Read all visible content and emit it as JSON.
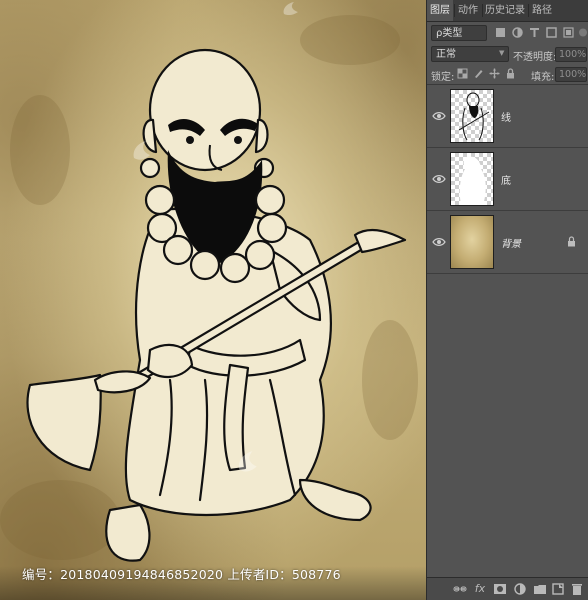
{
  "canvas": {
    "watermark": "编号：20180409194846852020 上传者ID：508776"
  },
  "panel": {
    "tabs": [
      "图层",
      "动作",
      "历史记录",
      "路径"
    ],
    "active_tab": 0,
    "filter": {
      "label": "ρ类型"
    },
    "blend_mode": "正常",
    "opacity": {
      "label": "不透明度:",
      "value": "100%"
    },
    "lock": {
      "label": "锁定:"
    },
    "fill": {
      "label": "填充:",
      "value": "100%"
    },
    "layers": [
      {
        "name": "线",
        "visible": true,
        "locked": false
      },
      {
        "name": "底",
        "visible": true,
        "locked": false
      },
      {
        "name": "背景",
        "visible": true,
        "locked": true
      }
    ],
    "bottom_icons": [
      "link-icon",
      "fx-icon",
      "mask-icon",
      "adjustment-icon",
      "group-icon",
      "new-layer-icon",
      "trash-icon"
    ]
  },
  "colors": {
    "panel_bg": "#535353",
    "tab_bar": "#3c3c3c",
    "parchment": "#c9b681",
    "ink": "#111111"
  }
}
